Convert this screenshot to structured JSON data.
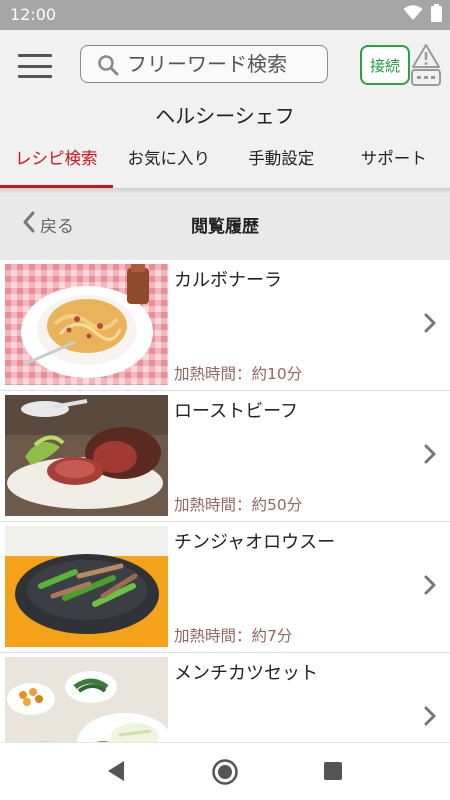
{
  "status_bar": {
    "time": "12:00",
    "icons": [
      "wifi-icon",
      "battery-icon"
    ]
  },
  "header": {
    "menu_icon": "hamburger-menu-icon",
    "search": {
      "placeholder": "フリーワード検索",
      "value": "",
      "icon": "search-icon"
    },
    "connect_label": "接続",
    "device_status_icon": "device-warning-icon",
    "app_title": "ヘルシーシェフ",
    "tabs": [
      {
        "label": "レシピ検索",
        "active": true
      },
      {
        "label": "お気に入り",
        "active": false
      },
      {
        "label": "手動設定",
        "active": false
      },
      {
        "label": "サポート",
        "active": false
      }
    ]
  },
  "sub_header": {
    "back_label": "戻る",
    "title": "閲覧履歴"
  },
  "recipes": [
    {
      "name": "カルボナーラ",
      "time": "加熱時間：約10分",
      "image": "carbonara-photo"
    },
    {
      "name": "ローストビーフ",
      "time": "加熱時間：約50分",
      "image": "roast-beef-photo"
    },
    {
      "name": "チンジャオロウスー",
      "time": "加熱時間：約7分",
      "image": "chinjao-rosu-photo"
    },
    {
      "name": "メンチカツセット",
      "time": "",
      "image": "menchi-katsu-set-photo"
    }
  ],
  "nav_bar": {
    "icons": [
      "back-triangle-icon",
      "home-circle-icon",
      "recents-square-icon"
    ]
  },
  "colors": {
    "accent": "#d0121b",
    "connect_green": "#2ea043",
    "time_text": "#946661",
    "status_bar": "#a6a6a6",
    "header_bg": "#f1f1f1"
  }
}
